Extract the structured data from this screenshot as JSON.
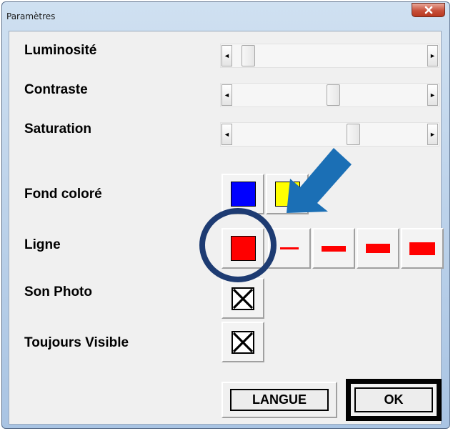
{
  "window": {
    "title": "Paramètres",
    "close_icon": "close-x-icon"
  },
  "sliders": [
    {
      "label": "Luminosité",
      "value_percent": 5
    },
    {
      "label": "Contraste",
      "value_percent": 52
    },
    {
      "label": "Saturation",
      "value_percent": 63
    }
  ],
  "fond_colore": {
    "label": "Fond coloré",
    "options": [
      {
        "name": "blue",
        "color": "#0000ff"
      },
      {
        "name": "yellow",
        "color": "#ffff00"
      }
    ]
  },
  "ligne": {
    "label": "Ligne",
    "color_swatch": "#ff0000",
    "thickness_options": [
      "thin",
      "medium",
      "thick",
      "extra-thick"
    ]
  },
  "son_photo": {
    "label": "Son Photo",
    "checked": true
  },
  "toujours_visible": {
    "label": "Toujours Visible",
    "checked": true
  },
  "buttons": {
    "langue": "LANGUE",
    "ok": "OK"
  },
  "annotations": {
    "arrow_color": "#1b6fb5",
    "circle_color": "#1d3b72",
    "arrow_icon": "pointer-arrow-icon",
    "circle_icon": "highlight-circle-icon"
  }
}
